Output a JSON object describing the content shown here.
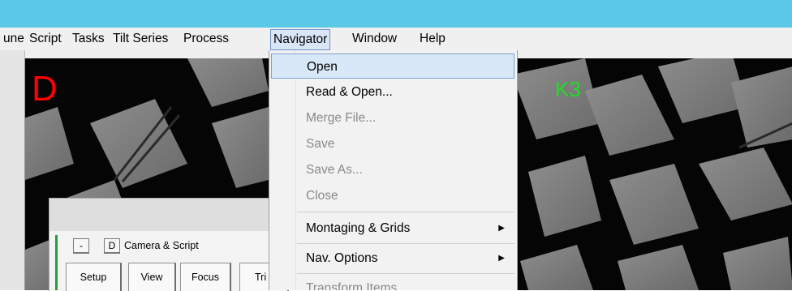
{
  "menubar": {
    "items": [
      {
        "label": "une"
      },
      {
        "label": "Script"
      },
      {
        "label": "Tasks"
      },
      {
        "label": "Tilt Series"
      },
      {
        "label": "Process"
      },
      {
        "label": "Navigator"
      },
      {
        "label": "Window"
      },
      {
        "label": "Help"
      }
    ]
  },
  "viewer": {
    "left_label": "D",
    "right_label": "K3",
    "left_label_color": "#ff0000",
    "right_label_color": "#22dd22"
  },
  "camera_panel": {
    "collapse_btn": "-",
    "d_btn": "D",
    "title": "Camera & Script",
    "tabs": [
      "Setup",
      "View",
      "Focus",
      "Tri"
    ]
  },
  "navigator_menu": {
    "items": [
      {
        "label": "Open",
        "state": "selected"
      },
      {
        "label": "Read & Open...",
        "state": "enabled"
      },
      {
        "label": "Merge File...",
        "state": "disabled"
      },
      {
        "label": "Save",
        "state": "disabled"
      },
      {
        "label": "Save As...",
        "state": "disabled"
      },
      {
        "label": "Close",
        "state": "disabled"
      },
      {
        "label": "Montaging & Grids",
        "state": "enabled",
        "submenu": true
      },
      {
        "label": "Nav. Options",
        "state": "enabled",
        "submenu": true
      },
      {
        "label": "Transform Items",
        "state": "disabled"
      }
    ],
    "submenu_arrow": "▶"
  }
}
